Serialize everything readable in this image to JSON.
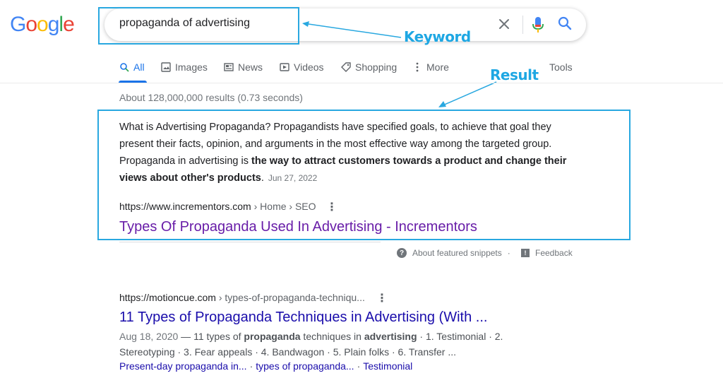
{
  "logo": {
    "letters": [
      "G",
      "o",
      "o",
      "g",
      "l",
      "e"
    ],
    "colors": [
      "#4285f4",
      "#ea4335",
      "#fbbc05",
      "#4285f4",
      "#34a853",
      "#ea4335"
    ]
  },
  "search": {
    "query": "propaganda of advertising"
  },
  "annotations": {
    "keyword": "Keyword",
    "result": "Result",
    "color": "#29a8e0"
  },
  "tabs": {
    "all": "All",
    "images": "Images",
    "news": "News",
    "videos": "Videos",
    "shopping": "Shopping",
    "more": "More",
    "tools": "Tools"
  },
  "stats": "About 128,000,000 results (0.73 seconds)",
  "snippet": {
    "text_plain": "What is Advertising Propaganda? Propagandists have specified goals, to achieve that goal they present their facts, opinion, and arguments in the most effective way among the targeted group. Propaganda in advertising is ",
    "text_bold": "the way to attract customers towards a product and change their views about other's products",
    "text_end": ".",
    "date": "Jun 27, 2022",
    "url_domain": "https://www.incrementors.com",
    "url_crumb": " › Home › SEO",
    "title": "Types Of Propaganda Used In Advertising - Incrementors"
  },
  "snippet_footer": {
    "about": "About featured snippets",
    "sep": "·",
    "feedback": "Feedback"
  },
  "result2": {
    "url_domain": "https://motioncue.com",
    "url_crumb": " › types-of-propaganda-techniqu...",
    "title": "11 Types of Propaganda Techniques in Advertising (With ...",
    "date": "Aug 18, 2020",
    "desc_1": " — 11 types of ",
    "desc_b1": "propaganda",
    "desc_2": " techniques in ",
    "desc_b2": "advertising",
    "desc_3": " · 1. Testimonial · 2. Stereotyping · 3. Fear appeals · 4. Bandwagon · 5. Plain folks · 6. Transfer ...",
    "sitelinks": [
      "Present-day propaganda in...",
      "types of propaganda...",
      "Testimonial"
    ]
  }
}
